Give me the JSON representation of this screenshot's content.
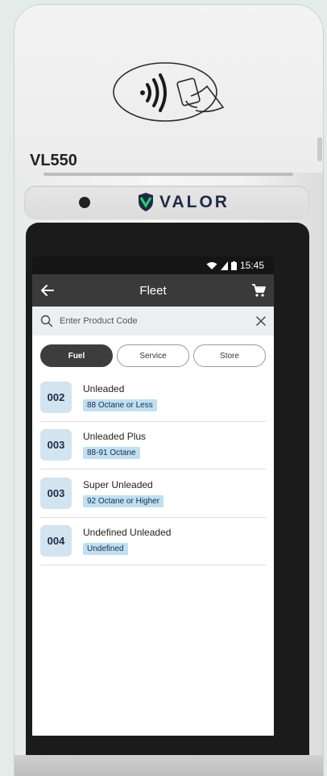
{
  "device": {
    "model": "VL550",
    "brand": "VALOR"
  },
  "status": {
    "time": "15:45"
  },
  "appbar": {
    "title": "Fleet"
  },
  "search": {
    "placeholder": "Enter Product Code",
    "value": ""
  },
  "tabs": [
    {
      "label": "Fuel",
      "active": true
    },
    {
      "label": "Service",
      "active": false
    },
    {
      "label": "Store",
      "active": false
    }
  ],
  "products": [
    {
      "code": "002",
      "name": "Unleaded",
      "tag": "88 Octane or Less"
    },
    {
      "code": "003",
      "name": "Unleaded Plus",
      "tag": "88-91 Octane"
    },
    {
      "code": "003",
      "name": "Super Unleaded",
      "tag": "92 Octane or Higher"
    },
    {
      "code": "004",
      "name": "Undefined Unleaded",
      "tag": "Undefined"
    }
  ],
  "colors": {
    "appbar": "#3a3a3a",
    "active_chip": "#3d3d3d",
    "code_box": "#d3e4f1",
    "tag": "#bfe0f2"
  }
}
